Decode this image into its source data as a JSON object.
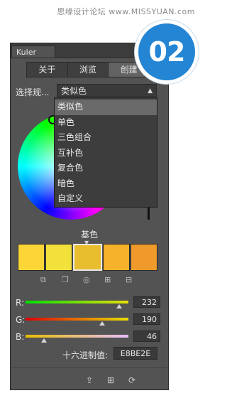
{
  "watermark": "思缘设计论坛 www.MISSYUAN.com",
  "badge": {
    "text": "02",
    "color": "#2385d3"
  },
  "panel": {
    "tab_title": "Kuler",
    "menu_icon": "panel-menu-icon"
  },
  "modes": [
    {
      "label": "关于",
      "selected": false
    },
    {
      "label": "浏览",
      "selected": false
    },
    {
      "label": "创建",
      "selected": true
    }
  ],
  "rule": {
    "label": "选择规...",
    "selected": "类似色"
  },
  "dropdown_options": [
    {
      "label": "类似色",
      "highlighted": true
    },
    {
      "label": "单色",
      "highlighted": false
    },
    {
      "label": "三色组合",
      "highlighted": false
    },
    {
      "label": "互补色",
      "highlighted": false
    },
    {
      "label": "复合色",
      "highlighted": false
    },
    {
      "label": "暗色",
      "highlighted": false
    },
    {
      "label": "自定义",
      "highlighted": false
    }
  ],
  "base_label": "基色",
  "swatches": [
    "#fbd636",
    "#f2e13a",
    "#e8be2e",
    "#f7b22b",
    "#ef9a2a"
  ],
  "base_swatch_index": 2,
  "sliders": [
    {
      "label": "R:",
      "value": "232",
      "fraction": 0.91,
      "gradient": "linear-gradient(to right,#00e000,#e8e000)"
    },
    {
      "label": "G:",
      "value": "190",
      "fraction": 0.745,
      "gradient": "linear-gradient(to right,#e00000,#e8e000)"
    },
    {
      "label": "B:",
      "value": "46",
      "fraction": 0.18,
      "gradient": "linear-gradient(to right,#e8be00,#e8beff)"
    }
  ],
  "hex": {
    "label": "十六进制值:",
    "value": "E8BE2E"
  },
  "tool_icons": [
    "set-base-icon",
    "copy-icon",
    "target-icon",
    "add-icon",
    "remove-icon"
  ],
  "bottom_icons": [
    "upload-icon",
    "add-theme-icon",
    "share-icon"
  ]
}
